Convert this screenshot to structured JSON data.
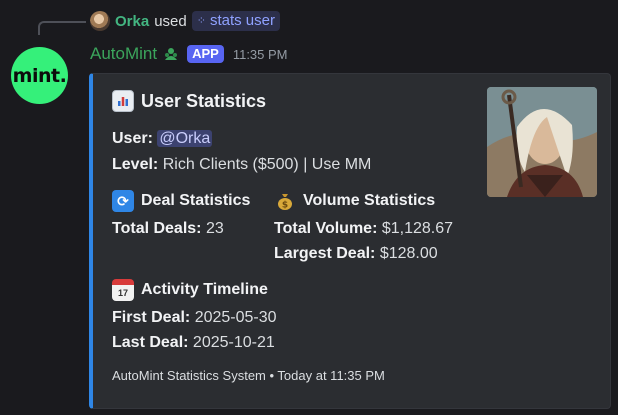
{
  "reply": {
    "username": "Orka",
    "action": "used",
    "command_icon": "slash-command-icon",
    "command": "stats user"
  },
  "message": {
    "avatar_text": "mint.",
    "bot_name": "AutoMint",
    "badge": "APP",
    "timestamp": "11:35 PM",
    "brand_color": "#35f07a",
    "name_color": "#3ba55c",
    "accent_color": "#2f86e6"
  },
  "embed": {
    "title_icon": "bar-chart-icon",
    "title": "User Statistics",
    "user_label": "User:",
    "user_mention": "@Orka",
    "level_label": "Level:",
    "level_value": "Rich Clients ($500) | Use MM",
    "deal_stats": {
      "icon": "refresh-cycle-icon",
      "heading": "Deal Statistics",
      "total_deals_label": "Total Deals:",
      "total_deals_value": "23"
    },
    "volume_stats": {
      "icon": "money-bag-icon",
      "heading": "Volume Statistics",
      "total_volume_label": "Total Volume:",
      "total_volume_value": "$1,128.67",
      "largest_deal_label": "Largest Deal:",
      "largest_deal_value": "$128.00"
    },
    "activity": {
      "icon": "calendar-icon",
      "heading": "Activity Timeline",
      "first_deal_label": "First Deal:",
      "first_deal_value": "2025-05-30",
      "last_deal_label": "Last Deal:",
      "last_deal_value": "2025-10-21"
    },
    "footer": "AutoMint Statistics System • Today at 11:35 PM"
  }
}
